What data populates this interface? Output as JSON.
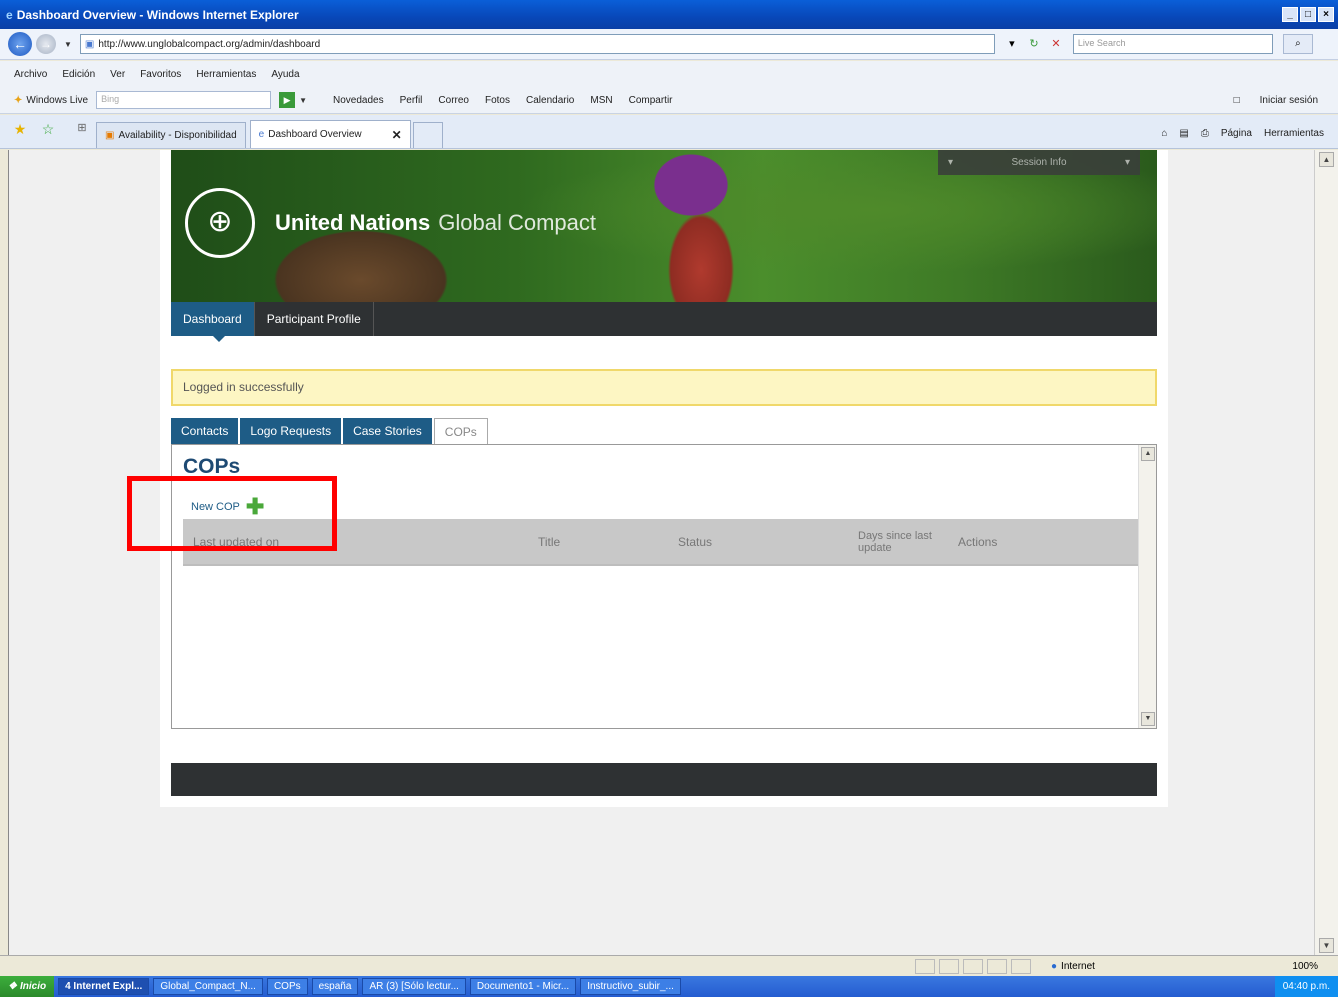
{
  "window": {
    "title": "Dashboard Overview - Windows Internet Explorer",
    "controls": [
      "_",
      "□",
      "×"
    ]
  },
  "address": {
    "url": "http://www.unglobalcompact.org/admin/dashboard",
    "search_placeholder": "Live Search"
  },
  "menu": [
    "Archivo",
    "Edición",
    "Ver",
    "Favoritos",
    "Herramientas",
    "Ayuda"
  ],
  "livebar": {
    "brand": "Windows Live",
    "search_placeholder": "Bing",
    "links": [
      "Novedades",
      "Perfil",
      "Correo",
      "Fotos",
      "Calendario",
      "MSN",
      "Compartir"
    ],
    "signin": "Iniciar sesión"
  },
  "tabs": [
    {
      "label": "Availability - Disponibilidad"
    },
    {
      "label": "Dashboard Overview"
    }
  ],
  "commandbar": {
    "page": "Página",
    "tools": "Herramientas"
  },
  "site": {
    "brand_bold": "United Nations",
    "brand_light": "Global Compact",
    "session_label": "Session Info",
    "nav": [
      "Dashboard",
      "Participant Profile"
    ],
    "flash": "Logged in successfully",
    "subtabs": [
      "Contacts",
      "Logo Requests",
      "Case Stories",
      "COPs"
    ],
    "heading": "COPs",
    "new_cop": "New COP",
    "columns": {
      "last_updated": "Last updated on",
      "title": "Title",
      "status": "Status",
      "days": "Days since last update",
      "actions": "Actions"
    }
  },
  "statusbar": {
    "zone": "Internet",
    "zoom": "100%"
  },
  "taskbar": {
    "start": "Inicio",
    "items": [
      "4 Internet Expl...",
      "Global_Compact_N...",
      "COPs",
      "españa",
      "AR (3) [Sólo lectur...",
      "Documento1 - Micr...",
      "Instructivo_subir_..."
    ],
    "clock": "04:40 p.m."
  },
  "colors": {
    "un_blue": "#1e5c86",
    "nav_dark": "#2e3133",
    "flash_bg": "#fdf6c3",
    "highlight_red": "#ff0000"
  }
}
